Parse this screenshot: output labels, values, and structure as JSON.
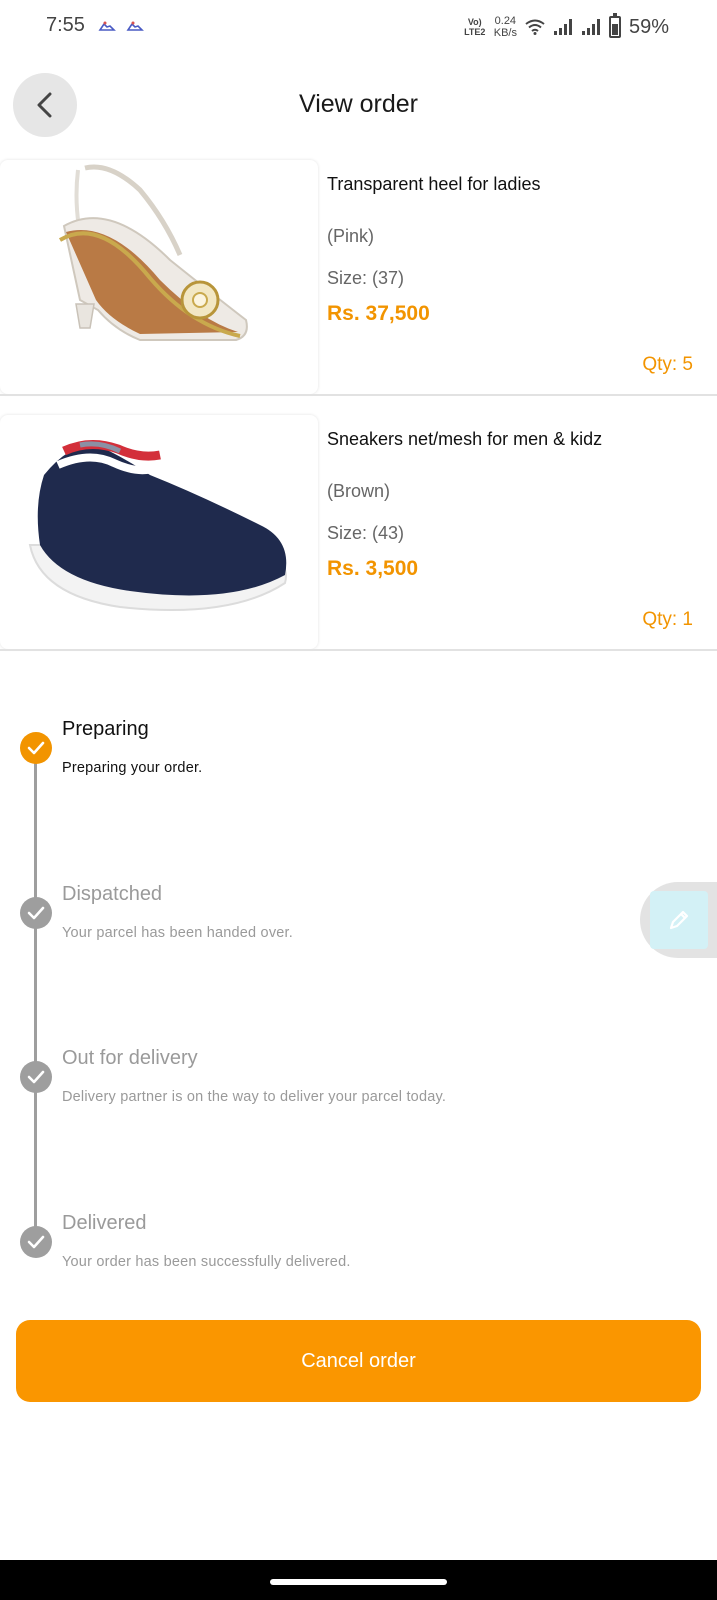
{
  "status_bar": {
    "time": "7:55",
    "network_type": "Vo) LTE2",
    "net_speed_value": "0.24",
    "net_speed_unit": "KB/s",
    "battery_percent": "59%",
    "battery_level": 0.59
  },
  "header": {
    "title": "View order"
  },
  "items": [
    {
      "name": "Transparent heel for ladies",
      "color": "(Pink)",
      "size": "Size: (37)",
      "price": "Rs. 37,500",
      "qty": "Qty: 5"
    },
    {
      "name": "Sneakers net/mesh for men & kidz",
      "color": "(Brown)",
      "size": "Size: (43)",
      "price": "Rs. 3,500",
      "qty": "Qty: 1"
    }
  ],
  "timeline": {
    "steps": [
      {
        "title": "Preparing",
        "desc": "Preparing your order.",
        "state": "active"
      },
      {
        "title": "Dispatched",
        "desc": "Your parcel has been handed over.",
        "state": "pending"
      },
      {
        "title": "Out for delivery",
        "desc": "Delivery partner is on the way to deliver your parcel today.",
        "state": "pending"
      },
      {
        "title": "Delivered",
        "desc": "Your order has been successfully delivered.",
        "state": "pending"
      }
    ]
  },
  "actions": {
    "cancel_label": "Cancel order"
  },
  "colors": {
    "accent": "#fa9600",
    "price": "#f29400",
    "step_active": "#f29400",
    "step_pending": "#9e9e9e"
  },
  "icons": {
    "back": "chevron-left-icon",
    "step_done": "check-circle-icon",
    "edit": "pen-icon"
  }
}
